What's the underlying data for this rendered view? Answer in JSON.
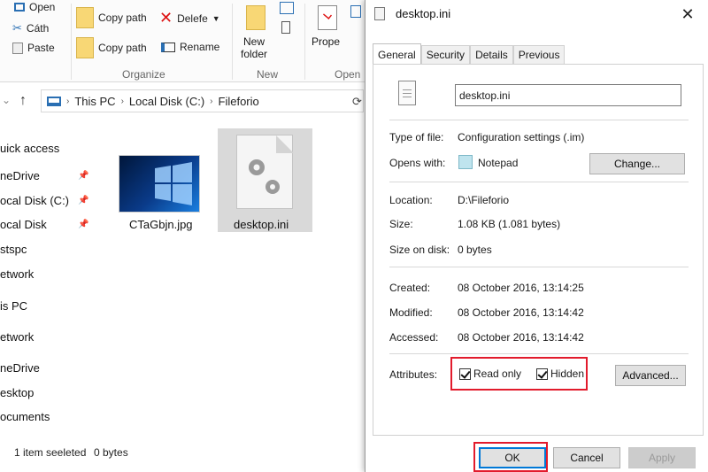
{
  "ribbon": {
    "open": "Open",
    "cath": "Cáth",
    "paste": "Paste",
    "copy_path_1": "Copy path",
    "copy_path_2": "Copy path",
    "delete": "Delefe",
    "rename": "Rename",
    "new_folder": "New\nfolder",
    "properties": "Prope",
    "group_organize": "Organize",
    "group_new": "New",
    "group_open": "Open"
  },
  "address": {
    "crumbs": [
      "This PC",
      "Local Disk (C:)",
      "Fileforio"
    ]
  },
  "navpane": {
    "items": [
      "uick access",
      "neDrive",
      "ocal Disk (C:)",
      "ocal Disk",
      "stspc",
      "etwork",
      "is PC",
      "etwork",
      "neDrive",
      "esktop",
      "ocuments"
    ]
  },
  "files": [
    {
      "name": "CTaGbjn.jpg"
    },
    {
      "name": "desktop.ini"
    }
  ],
  "status": {
    "selection": "1 item seeleted",
    "size": "0 bytes"
  },
  "dialog": {
    "title": "desktop.ini",
    "close_glyph": "✕",
    "tabs": [
      "General",
      "Security",
      "Details",
      "Previous"
    ],
    "file_name": "desktop.ini",
    "type_label": "Type of file:",
    "type_value": "Configuration settings (.im)",
    "opens_label": "Opens with:",
    "opens_value": "Notepad",
    "change_button": "Change...",
    "location_label": "Location:",
    "location_value": "D:\\Fileforio",
    "size_label": "Size:",
    "size_value": "1.08 KB (1.081 bytes)",
    "size_on_disk_label": "Size on disk:",
    "size_on_disk_value": "0 bytes",
    "created_label": "Created:",
    "created_value": "08 October 2016, 13:14:25",
    "modified_label": "Modified:",
    "modified_value": "08 October 2016, 13:14:42",
    "accessed_label": "Accessed:",
    "accessed_value": "08 October 2016, 13:14:42",
    "attributes_label": "Attributes:",
    "read_only_label": "Read only",
    "hidden_label": "Hidden",
    "read_only_checked": true,
    "hidden_checked": true,
    "advanced_button": "Advanced...",
    "ok_button": "OK",
    "cancel_button": "Cancel",
    "apply_button": "Apply"
  },
  "colors": {
    "highlight_red": "#e21b2c",
    "focus_blue": "#0078d7",
    "win_blue": "#1a7fe0"
  }
}
